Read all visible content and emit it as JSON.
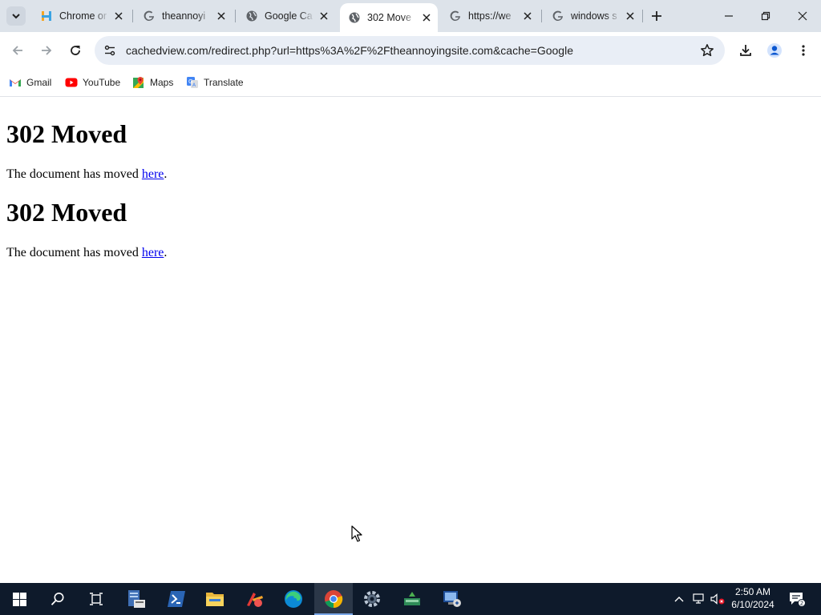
{
  "browser": {
    "tabs": [
      {
        "title": "Chrome or",
        "favicon": "hp-h-icon"
      },
      {
        "title": "theannoyi",
        "favicon": "google-g-icon"
      },
      {
        "title": "Google Ca",
        "favicon": "globe-icon"
      },
      {
        "title": "302 Move",
        "favicon": "globe-icon",
        "active": true
      },
      {
        "title": "https://we",
        "favicon": "google-g-icon"
      },
      {
        "title": "windows s",
        "favicon": "google-g-icon"
      }
    ],
    "address_url": "cachedview.com/redirect.php?url=https%3A%2F%2Ftheannoyingsite.com&cache=Google",
    "bookmarks": [
      {
        "label": "Gmail",
        "icon": "gmail-icon"
      },
      {
        "label": "YouTube",
        "icon": "youtube-icon"
      },
      {
        "label": "Maps",
        "icon": "maps-icon"
      },
      {
        "label": "Translate",
        "icon": "translate-icon"
      }
    ]
  },
  "page": {
    "blocks": [
      {
        "heading": "302 Moved",
        "text": "The document has moved",
        "link": "here",
        "end": "."
      },
      {
        "heading": "302 Moved",
        "text": "The document has moved",
        "link": "here",
        "end": "."
      }
    ]
  },
  "taskbar": {
    "apps": [
      "start-icon",
      "search-icon",
      "task-view-icon",
      "server-manager-icon",
      "powershell-icon",
      "file-explorer-icon",
      "ccleaner-icon",
      "edge-icon",
      "chrome-icon",
      "settings-icon",
      "network-app-icon",
      "remote-desktop-icon"
    ],
    "active_app": "chrome-icon",
    "clock_time": "2:50 AM",
    "clock_date": "6/10/2024",
    "notification_count": "2"
  },
  "colors": {
    "tabstrip_bg": "#dde3ea",
    "omnibox_bg": "#e9eef6",
    "link": "#0000ee",
    "taskbar_bg": "#0e1a2b"
  }
}
